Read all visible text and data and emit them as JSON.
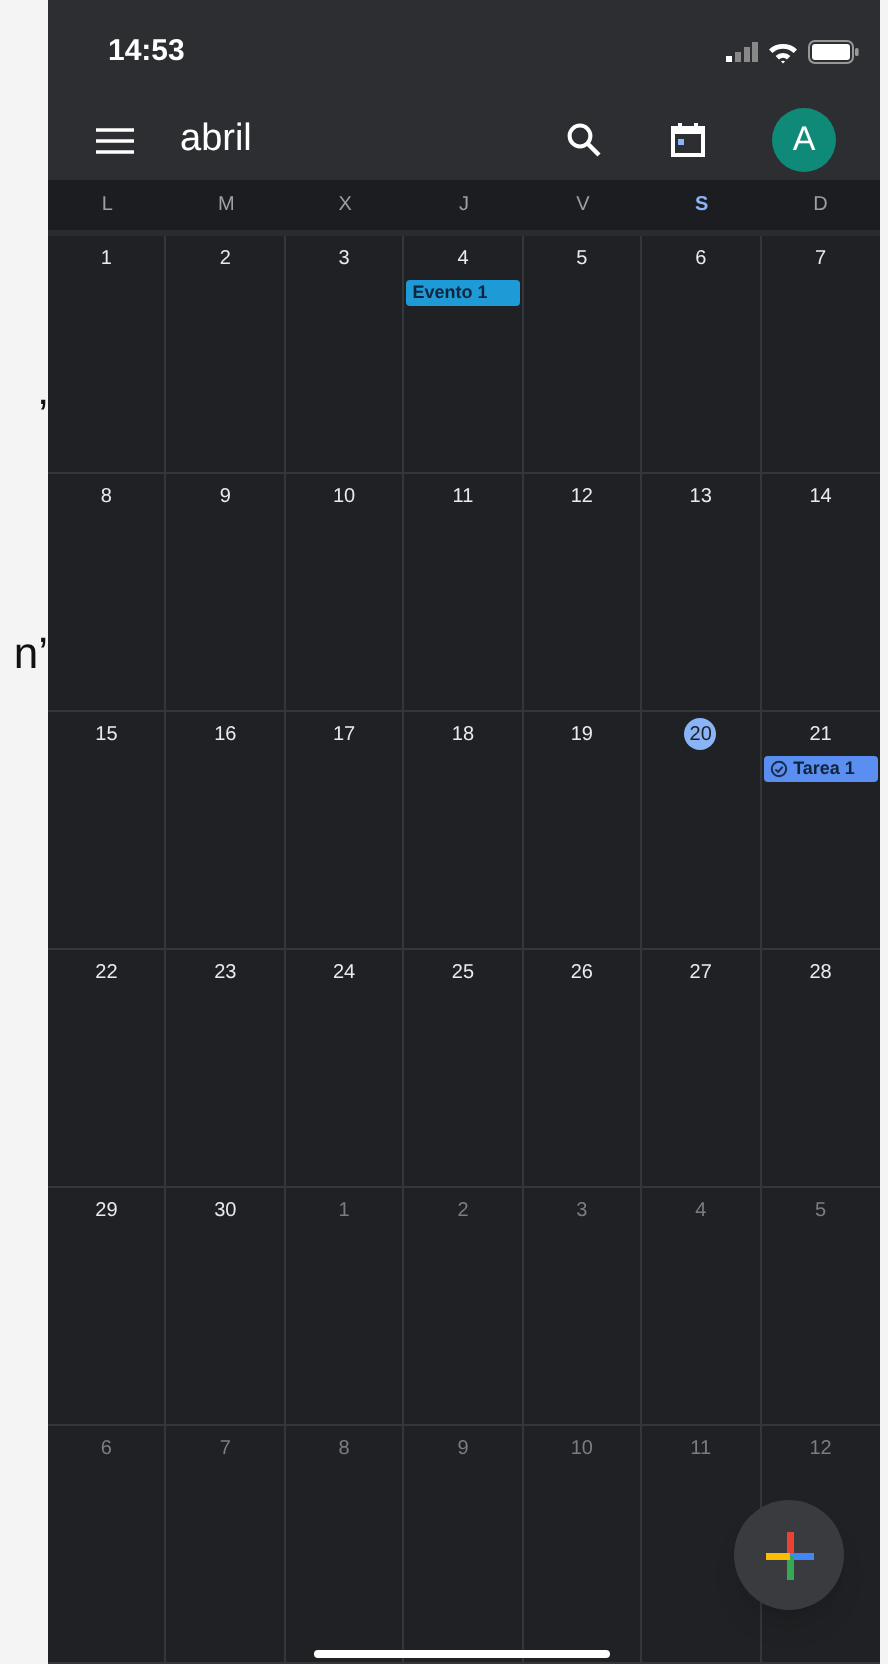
{
  "side_text": [
    "’",
    "n’"
  ],
  "status_bar": {
    "time": "14:53"
  },
  "toolbar": {
    "title": "abril",
    "avatar": "A"
  },
  "weekdays": [
    {
      "label": "L",
      "selected": false
    },
    {
      "label": "M",
      "selected": false
    },
    {
      "label": "X",
      "selected": false
    },
    {
      "label": "J",
      "selected": false
    },
    {
      "label": "V",
      "selected": false
    },
    {
      "label": "S",
      "selected": true
    },
    {
      "label": "D",
      "selected": false
    }
  ],
  "weeks": [
    [
      {
        "day": "1",
        "muted": false,
        "today": false
      },
      {
        "day": "2",
        "muted": false,
        "today": false
      },
      {
        "day": "3",
        "muted": false,
        "today": false
      },
      {
        "day": "4",
        "muted": false,
        "today": false,
        "events": [
          {
            "kind": "event",
            "label": "Evento 1",
            "color": "#1e9ad6"
          }
        ]
      },
      {
        "day": "5",
        "muted": false,
        "today": false
      },
      {
        "day": "6",
        "muted": false,
        "today": false
      },
      {
        "day": "7",
        "muted": false,
        "today": false
      }
    ],
    [
      {
        "day": "8",
        "muted": false,
        "today": false
      },
      {
        "day": "9",
        "muted": false,
        "today": false
      },
      {
        "day": "10",
        "muted": false,
        "today": false
      },
      {
        "day": "11",
        "muted": false,
        "today": false
      },
      {
        "day": "12",
        "muted": false,
        "today": false
      },
      {
        "day": "13",
        "muted": false,
        "today": false
      },
      {
        "day": "14",
        "muted": false,
        "today": false
      }
    ],
    [
      {
        "day": "15",
        "muted": false,
        "today": false
      },
      {
        "day": "16",
        "muted": false,
        "today": false
      },
      {
        "day": "17",
        "muted": false,
        "today": false
      },
      {
        "day": "18",
        "muted": false,
        "today": false
      },
      {
        "day": "19",
        "muted": false,
        "today": false
      },
      {
        "day": "20",
        "muted": false,
        "today": true
      },
      {
        "day": "21",
        "muted": false,
        "today": false,
        "events": [
          {
            "kind": "task",
            "label": "Tarea 1",
            "color": "#5a8ef0"
          }
        ]
      }
    ],
    [
      {
        "day": "22",
        "muted": false,
        "today": false
      },
      {
        "day": "23",
        "muted": false,
        "today": false
      },
      {
        "day": "24",
        "muted": false,
        "today": false
      },
      {
        "day": "25",
        "muted": false,
        "today": false
      },
      {
        "day": "26",
        "muted": false,
        "today": false
      },
      {
        "day": "27",
        "muted": false,
        "today": false
      },
      {
        "day": "28",
        "muted": false,
        "today": false
      }
    ],
    [
      {
        "day": "29",
        "muted": false,
        "today": false
      },
      {
        "day": "30",
        "muted": false,
        "today": false
      },
      {
        "day": "1",
        "muted": true,
        "today": false
      },
      {
        "day": "2",
        "muted": true,
        "today": false
      },
      {
        "day": "3",
        "muted": true,
        "today": false
      },
      {
        "day": "4",
        "muted": true,
        "today": false
      },
      {
        "day": "5",
        "muted": true,
        "today": false
      }
    ],
    [
      {
        "day": "6",
        "muted": true,
        "today": false
      },
      {
        "day": "7",
        "muted": true,
        "today": false
      },
      {
        "day": "8",
        "muted": true,
        "today": false
      },
      {
        "day": "9",
        "muted": true,
        "today": false
      },
      {
        "day": "10",
        "muted": true,
        "today": false
      },
      {
        "day": "11",
        "muted": true,
        "today": false
      },
      {
        "day": "12",
        "muted": true,
        "today": false
      }
    ]
  ]
}
